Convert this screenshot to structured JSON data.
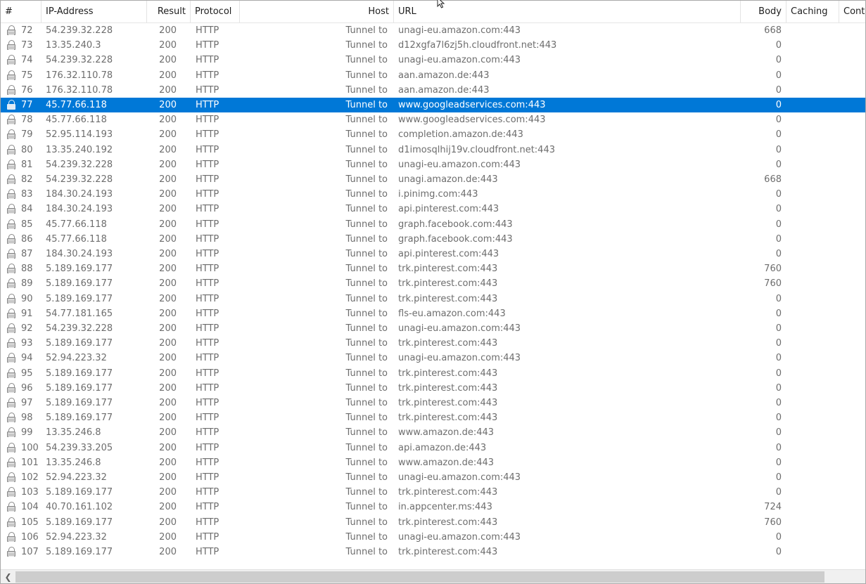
{
  "columns": {
    "num": "#",
    "ip": "IP-Address",
    "result": "Result",
    "protocol": "Protocol",
    "host": "Host",
    "url": "URL",
    "body": "Body",
    "caching": "Caching",
    "content": "Conte"
  },
  "icons": {
    "row": "lock-icon",
    "scroll_left": "chevron-left-icon",
    "cursor": "mouse-pointer-icon"
  },
  "colors": {
    "selection": "#0078d7",
    "text": "#6d6d6d",
    "header_text": "#1e1e1e"
  },
  "selected_row": "77",
  "rows": [
    {
      "num": "72",
      "ip": "54.239.32.228",
      "result": "200",
      "protocol": "HTTP",
      "host": "Tunnel to",
      "url": "unagi-eu.amazon.com:443",
      "body": "668"
    },
    {
      "num": "73",
      "ip": "13.35.240.3",
      "result": "200",
      "protocol": "HTTP",
      "host": "Tunnel to",
      "url": "d12xgfa7l6zj5h.cloudfront.net:443",
      "body": "0"
    },
    {
      "num": "74",
      "ip": "54.239.32.228",
      "result": "200",
      "protocol": "HTTP",
      "host": "Tunnel to",
      "url": "unagi-eu.amazon.com:443",
      "body": "0"
    },
    {
      "num": "75",
      "ip": "176.32.110.78",
      "result": "200",
      "protocol": "HTTP",
      "host": "Tunnel to",
      "url": "aan.amazon.de:443",
      "body": "0"
    },
    {
      "num": "76",
      "ip": "176.32.110.78",
      "result": "200",
      "protocol": "HTTP",
      "host": "Tunnel to",
      "url": "aan.amazon.de:443",
      "body": "0"
    },
    {
      "num": "77",
      "ip": "45.77.66.118",
      "result": "200",
      "protocol": "HTTP",
      "host": "Tunnel to",
      "url": "www.googleadservices.com:443",
      "body": "0"
    },
    {
      "num": "78",
      "ip": "45.77.66.118",
      "result": "200",
      "protocol": "HTTP",
      "host": "Tunnel to",
      "url": "www.googleadservices.com:443",
      "body": "0"
    },
    {
      "num": "79",
      "ip": "52.95.114.193",
      "result": "200",
      "protocol": "HTTP",
      "host": "Tunnel to",
      "url": "completion.amazon.de:443",
      "body": "0"
    },
    {
      "num": "80",
      "ip": "13.35.240.192",
      "result": "200",
      "protocol": "HTTP",
      "host": "Tunnel to",
      "url": "d1imosqlhij19v.cloudfront.net:443",
      "body": "0"
    },
    {
      "num": "81",
      "ip": "54.239.32.228",
      "result": "200",
      "protocol": "HTTP",
      "host": "Tunnel to",
      "url": "unagi-eu.amazon.com:443",
      "body": "0"
    },
    {
      "num": "82",
      "ip": "54.239.32.228",
      "result": "200",
      "protocol": "HTTP",
      "host": "Tunnel to",
      "url": "unagi.amazon.de:443",
      "body": "668"
    },
    {
      "num": "83",
      "ip": "184.30.24.193",
      "result": "200",
      "protocol": "HTTP",
      "host": "Tunnel to",
      "url": "i.pinimg.com:443",
      "body": "0"
    },
    {
      "num": "84",
      "ip": "184.30.24.193",
      "result": "200",
      "protocol": "HTTP",
      "host": "Tunnel to",
      "url": "api.pinterest.com:443",
      "body": "0"
    },
    {
      "num": "85",
      "ip": "45.77.66.118",
      "result": "200",
      "protocol": "HTTP",
      "host": "Tunnel to",
      "url": "graph.facebook.com:443",
      "body": "0"
    },
    {
      "num": "86",
      "ip": "45.77.66.118",
      "result": "200",
      "protocol": "HTTP",
      "host": "Tunnel to",
      "url": "graph.facebook.com:443",
      "body": "0"
    },
    {
      "num": "87",
      "ip": "184.30.24.193",
      "result": "200",
      "protocol": "HTTP",
      "host": "Tunnel to",
      "url": "api.pinterest.com:443",
      "body": "0"
    },
    {
      "num": "88",
      "ip": "5.189.169.177",
      "result": "200",
      "protocol": "HTTP",
      "host": "Tunnel to",
      "url": "trk.pinterest.com:443",
      "body": "760"
    },
    {
      "num": "89",
      "ip": "5.189.169.177",
      "result": "200",
      "protocol": "HTTP",
      "host": "Tunnel to",
      "url": "trk.pinterest.com:443",
      "body": "760"
    },
    {
      "num": "90",
      "ip": "5.189.169.177",
      "result": "200",
      "protocol": "HTTP",
      "host": "Tunnel to",
      "url": "trk.pinterest.com:443",
      "body": "0"
    },
    {
      "num": "91",
      "ip": "54.77.181.165",
      "result": "200",
      "protocol": "HTTP",
      "host": "Tunnel to",
      "url": "fls-eu.amazon.com:443",
      "body": "0"
    },
    {
      "num": "92",
      "ip": "54.239.32.228",
      "result": "200",
      "protocol": "HTTP",
      "host": "Tunnel to",
      "url": "unagi-eu.amazon.com:443",
      "body": "0"
    },
    {
      "num": "93",
      "ip": "5.189.169.177",
      "result": "200",
      "protocol": "HTTP",
      "host": "Tunnel to",
      "url": "trk.pinterest.com:443",
      "body": "0"
    },
    {
      "num": "94",
      "ip": "52.94.223.32",
      "result": "200",
      "protocol": "HTTP",
      "host": "Tunnel to",
      "url": "unagi-eu.amazon.com:443",
      "body": "0"
    },
    {
      "num": "95",
      "ip": "5.189.169.177",
      "result": "200",
      "protocol": "HTTP",
      "host": "Tunnel to",
      "url": "trk.pinterest.com:443",
      "body": "0"
    },
    {
      "num": "96",
      "ip": "5.189.169.177",
      "result": "200",
      "protocol": "HTTP",
      "host": "Tunnel to",
      "url": "trk.pinterest.com:443",
      "body": "0"
    },
    {
      "num": "97",
      "ip": "5.189.169.177",
      "result": "200",
      "protocol": "HTTP",
      "host": "Tunnel to",
      "url": "trk.pinterest.com:443",
      "body": "0"
    },
    {
      "num": "98",
      "ip": "5.189.169.177",
      "result": "200",
      "protocol": "HTTP",
      "host": "Tunnel to",
      "url": "trk.pinterest.com:443",
      "body": "0"
    },
    {
      "num": "99",
      "ip": "13.35.246.8",
      "result": "200",
      "protocol": "HTTP",
      "host": "Tunnel to",
      "url": "www.amazon.de:443",
      "body": "0"
    },
    {
      "num": "100",
      "ip": "54.239.33.205",
      "result": "200",
      "protocol": "HTTP",
      "host": "Tunnel to",
      "url": "api.amazon.de:443",
      "body": "0"
    },
    {
      "num": "101",
      "ip": "13.35.246.8",
      "result": "200",
      "protocol": "HTTP",
      "host": "Tunnel to",
      "url": "www.amazon.de:443",
      "body": "0"
    },
    {
      "num": "102",
      "ip": "52.94.223.32",
      "result": "200",
      "protocol": "HTTP",
      "host": "Tunnel to",
      "url": "unagi-eu.amazon.com:443",
      "body": "0"
    },
    {
      "num": "103",
      "ip": "5.189.169.177",
      "result": "200",
      "protocol": "HTTP",
      "host": "Tunnel to",
      "url": "trk.pinterest.com:443",
      "body": "0"
    },
    {
      "num": "104",
      "ip": "40.70.161.102",
      "result": "200",
      "protocol": "HTTP",
      "host": "Tunnel to",
      "url": "in.appcenter.ms:443",
      "body": "724"
    },
    {
      "num": "105",
      "ip": "5.189.169.177",
      "result": "200",
      "protocol": "HTTP",
      "host": "Tunnel to",
      "url": "trk.pinterest.com:443",
      "body": "760"
    },
    {
      "num": "106",
      "ip": "52.94.223.32",
      "result": "200",
      "protocol": "HTTP",
      "host": "Tunnel to",
      "url": "unagi-eu.amazon.com:443",
      "body": "0"
    },
    {
      "num": "107",
      "ip": "5.189.169.177",
      "result": "200",
      "protocol": "HTTP",
      "host": "Tunnel to",
      "url": "trk.pinterest.com:443",
      "body": "0"
    }
  ]
}
